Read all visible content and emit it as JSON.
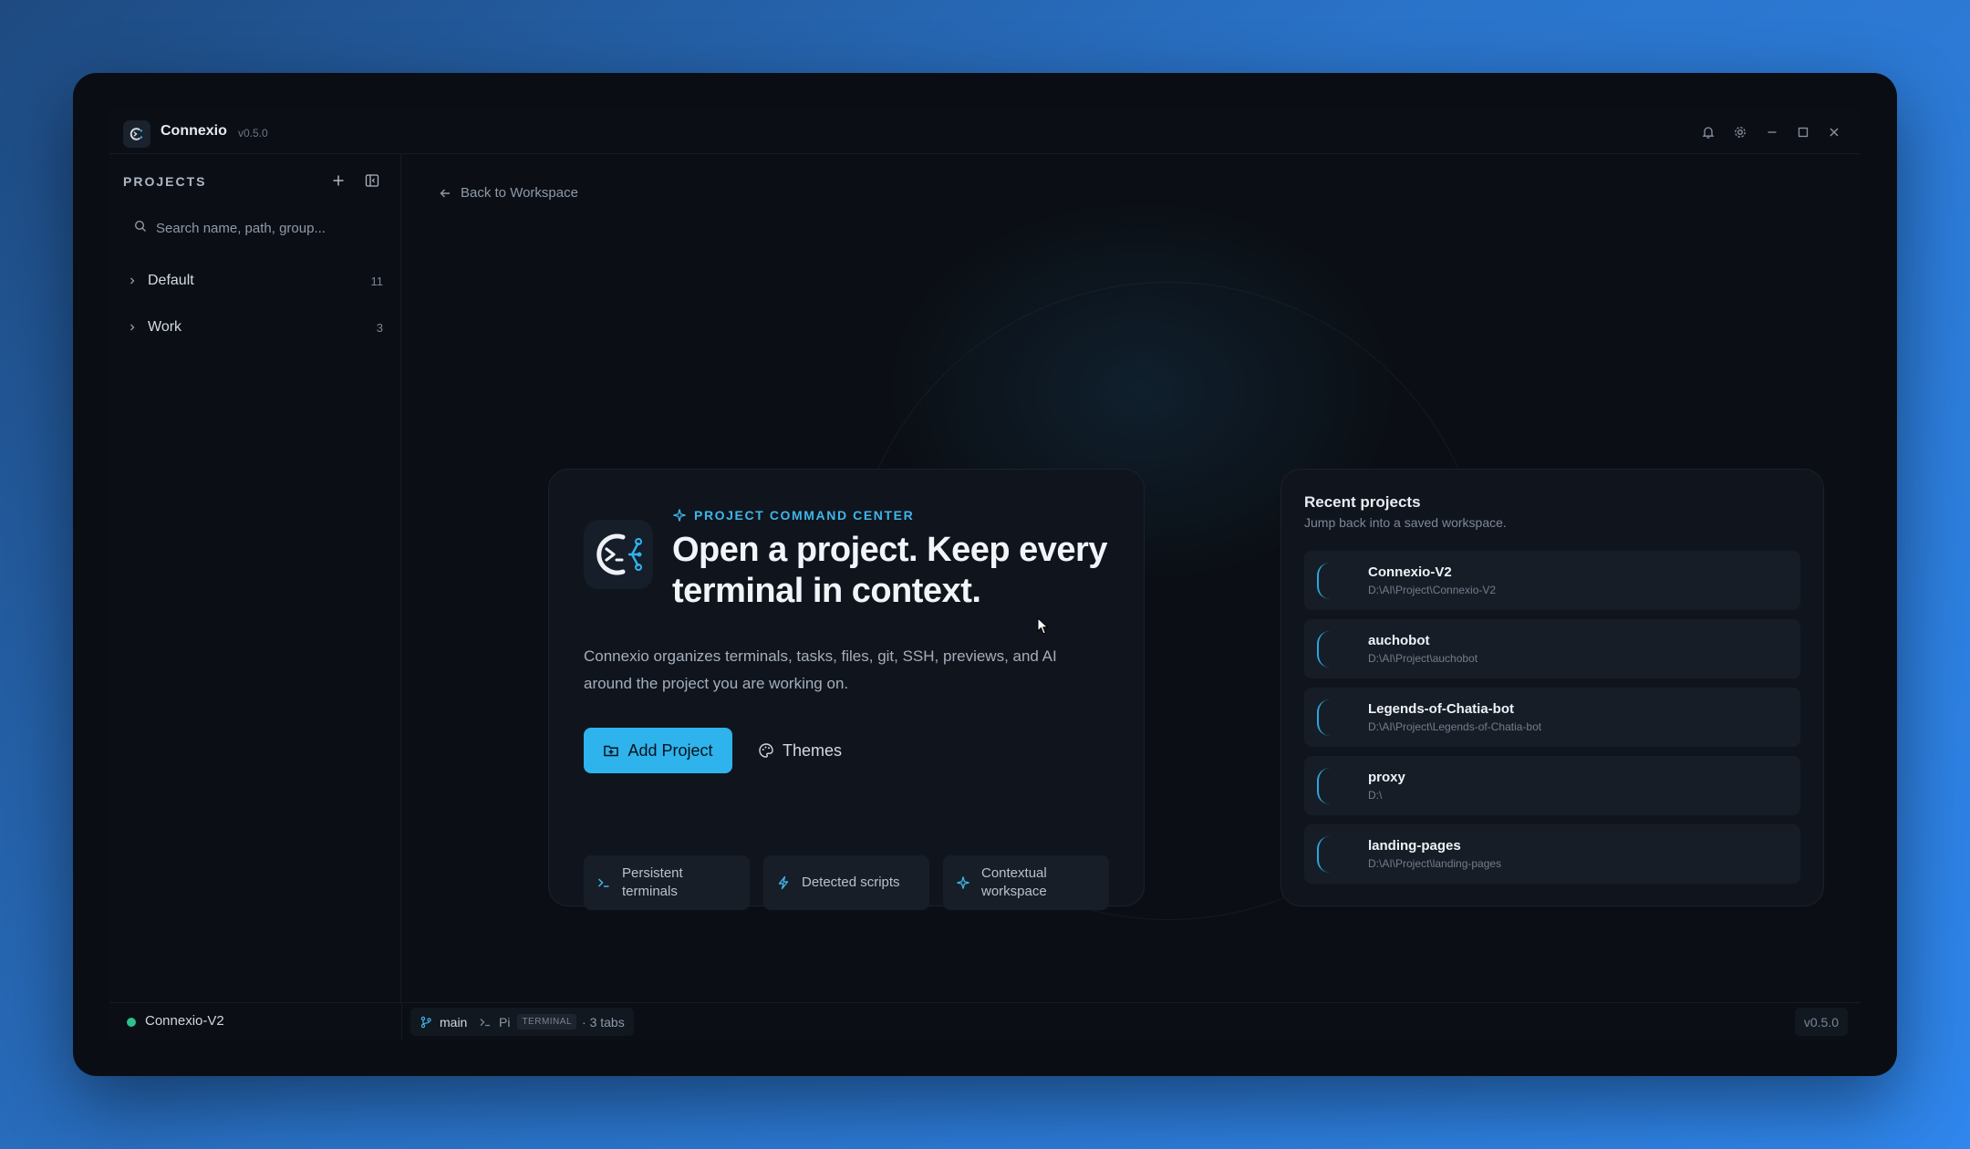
{
  "app": {
    "title": "Connexio",
    "version": "v0.5.0"
  },
  "sidebar": {
    "header": "PROJECTS",
    "search_placeholder": "Search name, path, group...",
    "groups": [
      {
        "name": "Default",
        "count": "11"
      },
      {
        "name": "Work",
        "count": "3"
      }
    ]
  },
  "main": {
    "back_label": "Back to Workspace",
    "hero": {
      "eyebrow": "PROJECT COMMAND CENTER",
      "title": "Open a project. Keep every terminal in context.",
      "description": "Connexio organizes terminals, tasks, files, git, SSH, previews, and AI around the project you are working on.",
      "primary_button": "Add Project",
      "secondary_button": "Themes",
      "features": [
        {
          "label": "Persistent terminals",
          "icon": "terminal-icon"
        },
        {
          "label": "Detected scripts",
          "icon": "bolt-icon"
        },
        {
          "label": "Contextual workspace",
          "icon": "sparkle-icon"
        }
      ]
    },
    "recent": {
      "title": "Recent projects",
      "subtitle": "Jump back into a saved workspace.",
      "projects": [
        {
          "name": "Connexio-V2",
          "path": "D:\\AI\\Project\\Connexio-V2"
        },
        {
          "name": "auchobot",
          "path": "D:\\AI\\Project\\auchobot"
        },
        {
          "name": "Legends-of-Chatia-bot",
          "path": "D:\\AI\\Project\\Legends-of-Chatia-bot"
        },
        {
          "name": "proxy",
          "path": "D:\\"
        },
        {
          "name": "landing-pages",
          "path": "D:\\AI\\Project\\landing-pages"
        }
      ]
    }
  },
  "statusbar": {
    "active_project": "Connexio-V2",
    "branch": "main",
    "shell": "Pi",
    "shell_tag": "TERMINAL",
    "tabs": "· 3 tabs",
    "version": "v0.5.0"
  },
  "colors": {
    "accent": "#2fb3ec",
    "status_ok": "#2fc08a",
    "background": "#0b0f15"
  }
}
